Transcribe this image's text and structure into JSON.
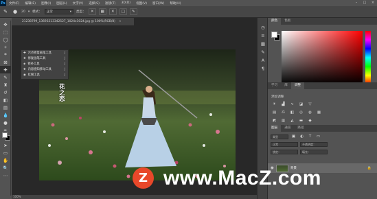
{
  "menubar": {
    "logo": "Ps",
    "items": [
      "文件(F)",
      "编辑(E)",
      "图像(I)",
      "图层(L)",
      "文字(Y)",
      "选择(S)",
      "滤镜(T)",
      "3D(D)",
      "视图(V)",
      "窗口(W)",
      "帮助(H)"
    ]
  },
  "options": {
    "brush_size": "20",
    "mode_label": "模式：",
    "mode_value": "正常",
    "type_label": "类型："
  },
  "document": {
    "tab_title": "21238799_13693213342527_1024x1024.jpg @ 100%(RGB/8)",
    "status": "100%"
  },
  "flyout": {
    "items": [
      {
        "label": "污点修复画笔工具",
        "shortcut": "J"
      },
      {
        "label": "修复画笔工具",
        "shortcut": "J"
      },
      {
        "label": "修补工具",
        "shortcut": "J"
      },
      {
        "label": "内容感知移动工具",
        "shortcut": "J"
      },
      {
        "label": "红眼工具",
        "shortcut": "J"
      }
    ]
  },
  "canvas": {
    "watermark_text": "花之恋"
  },
  "panels": {
    "color_tabs": [
      "颜色",
      "色板"
    ],
    "adjust_tabs": [
      "学习",
      "库",
      "调整"
    ],
    "adjust_title": "添加调整",
    "layer_tabs": [
      "图层",
      "通道",
      "路径"
    ],
    "kind_label": "类型",
    "mode_label": "正常",
    "opacity_label": "不透明度：",
    "lock_label": "锁定：",
    "fill_label": "填充：",
    "layer_name": "背景"
  },
  "brand": {
    "logo_letter": "Z",
    "site": "www.MacZ.com",
    "accent": "#e8482a"
  }
}
